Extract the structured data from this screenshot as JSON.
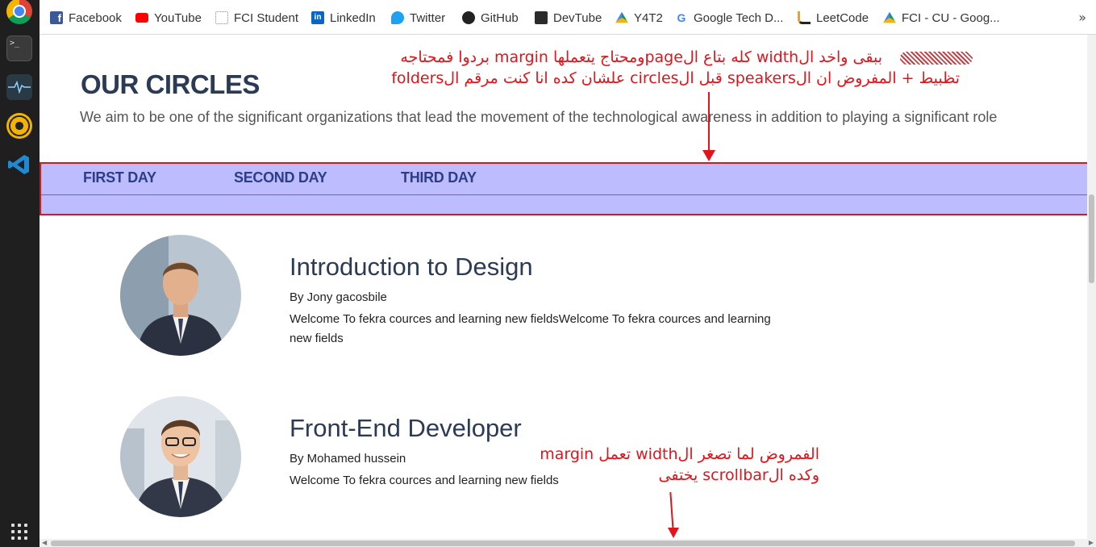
{
  "bookmarks": [
    {
      "label": "Facebook",
      "icon": "facebook-icon",
      "color": "#3b5998"
    },
    {
      "label": "YouTube",
      "icon": "youtube-icon",
      "color": "#ff0000"
    },
    {
      "label": "FCI Student",
      "icon": "fci-icon",
      "color": "#6a8caf"
    },
    {
      "label": "LinkedIn",
      "icon": "linkedin-icon",
      "color": "#0a66c2"
    },
    {
      "label": "Twitter",
      "icon": "twitter-icon",
      "color": "#1da1f2"
    },
    {
      "label": "GitHub",
      "icon": "github-icon",
      "color": "#222222"
    },
    {
      "label": "DevTube",
      "icon": "devtube-icon",
      "color": "#2b2b2b"
    },
    {
      "label": "Y4T2",
      "icon": "drive-icon",
      "color": "#0f9d58"
    },
    {
      "label": "Google Tech D...",
      "icon": "google-icon",
      "color": "#4285f4"
    },
    {
      "label": "LeetCode",
      "icon": "leetcode-icon",
      "color": "#f89f1b"
    },
    {
      "label": "FCI - CU - Goog...",
      "icon": "drive-icon",
      "color": "#0f9d58"
    }
  ],
  "more_label": "»",
  "page": {
    "title": "OUR CIRCLES",
    "description": "We aim to be one of the significant organizations that lead the movement of the technological awareness in addition to playing a significant role",
    "tabs": [
      "FIRST DAY",
      "SECOND DAY",
      "THIRD DAY"
    ]
  },
  "speakers": [
    {
      "title": "Introduction to Design",
      "by": "By Jony gacosbile",
      "text": "Welcome To fekra cources and learning new fieldsWelcome To fekra cources and learning new fields"
    },
    {
      "title": "Front-End Developer",
      "by": "By Mohamed hussein",
      "text": "Welcome To fekra cources and learning new fields"
    }
  ],
  "annotations": {
    "note1_line1": "ببقى واخد الwidth كله بتاع الpageومحتاج يتعملها margin بردوا فمحتاجه",
    "note1_line2": "تظبيط + المفروض ان الspeakers قبل الcircles علشان كده انا كنت مرقم الfolders",
    "note2_line1": "الفمروض لما تصغر الwidth تعمل margin",
    "note2_line2": "وكده الscrollbar يختفى"
  },
  "colors": {
    "tab_bar_bg": "#bcbcff",
    "annotation_red": "#e0141b",
    "title_navy": "#2b3a55"
  }
}
